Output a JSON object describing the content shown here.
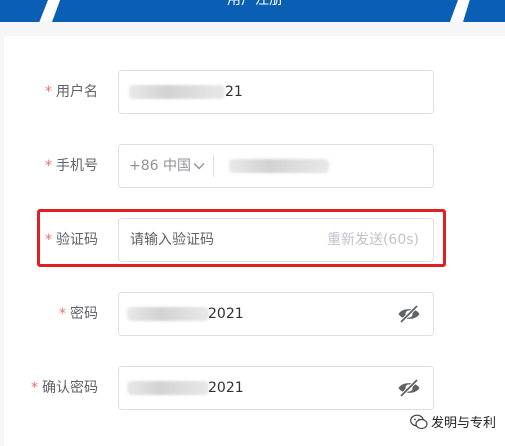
{
  "header": {
    "title": "用户注册"
  },
  "form": {
    "username": {
      "label": "用户名",
      "required_mark": "*",
      "value_suffix": "21"
    },
    "phone": {
      "label": "手机号",
      "required_mark": "*",
      "country_code": "+86 中国"
    },
    "code": {
      "label": "验证码",
      "required_mark": "*",
      "placeholder": "请输入验证码",
      "resend_label": "重新发送(60s)"
    },
    "password": {
      "label": "密码",
      "required_mark": "*",
      "value_suffix": "2021",
      "icon": "eye-slash-icon"
    },
    "confirm_password": {
      "label": "确认密码",
      "required_mark": "*",
      "value_suffix": "2021",
      "icon": "eye-slash-icon"
    }
  },
  "watermark": {
    "text": "发明与专利"
  },
  "colors": {
    "header_blue": "#0a5fb4",
    "required_red": "#f56c6c",
    "highlight_red": "#e02020",
    "border": "#dcdfe6"
  }
}
